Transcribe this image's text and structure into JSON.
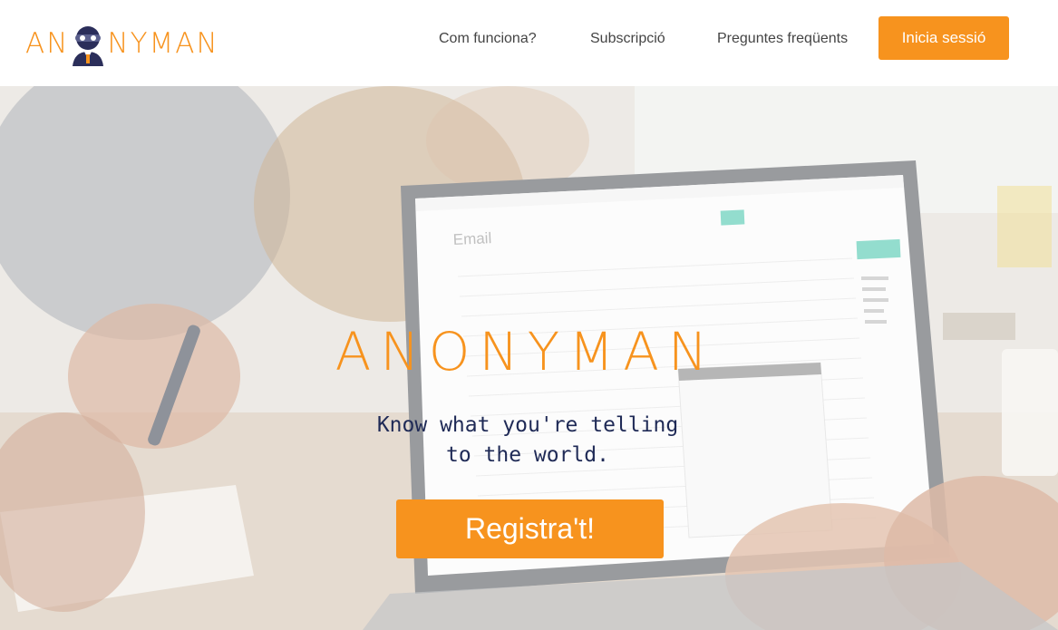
{
  "brand": {
    "logo_text_left": "AN",
    "logo_text_right": "NYMAN",
    "hero_wordmark": "ANONYMAN",
    "color": "#f7931e"
  },
  "nav": {
    "how_it_works": "Com funciona?",
    "subscription": "Subscripció",
    "faq": "Preguntes freqüents",
    "login": "Inicia sessió"
  },
  "hero": {
    "tagline_line1": "Know what you're telling",
    "tagline_line2": "to the world.",
    "register": "Registra't!",
    "tagline_color": "#1f2a56"
  },
  "laptop_screen": {
    "app_label": "Email"
  }
}
